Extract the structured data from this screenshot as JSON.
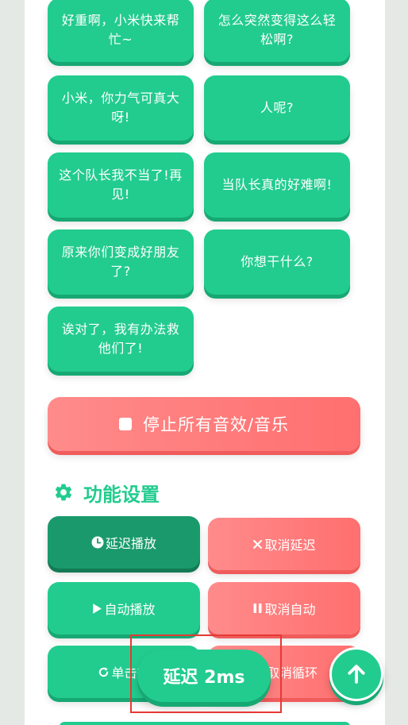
{
  "sound_buttons": [
    {
      "label": "好重啊，小米快来帮忙~"
    },
    {
      "label": "怎么突然变得这么轻松啊?"
    },
    {
      "label": "小米，你力气可真大呀!"
    },
    {
      "label": "人呢?"
    },
    {
      "label": "这个队长我不当了!再见!"
    },
    {
      "label": "当队长真的好难啊!"
    },
    {
      "label": "原来你们变成好朋友了?"
    },
    {
      "label": "你想干什么?"
    },
    {
      "label": "诶对了，我有办法救他们了!"
    }
  ],
  "stop_all": {
    "label": "停止所有音效/音乐",
    "icon": "stop-square-icon"
  },
  "settings": {
    "title": "功能设置",
    "icon": "gear-icon",
    "delay_play": "延迟播放",
    "cancel_delay": "取消延迟",
    "auto_play": "自动播放",
    "cancel_auto": "取消自动",
    "single_loop": "单击循",
    "cancel_loop": "取消循环"
  },
  "toast": {
    "text": "延迟 2ms"
  },
  "colors": {
    "green": "#22cc8e",
    "dark_green": "#1a9a6c",
    "red": "#ff7575",
    "highlight_border": "#e53935"
  }
}
